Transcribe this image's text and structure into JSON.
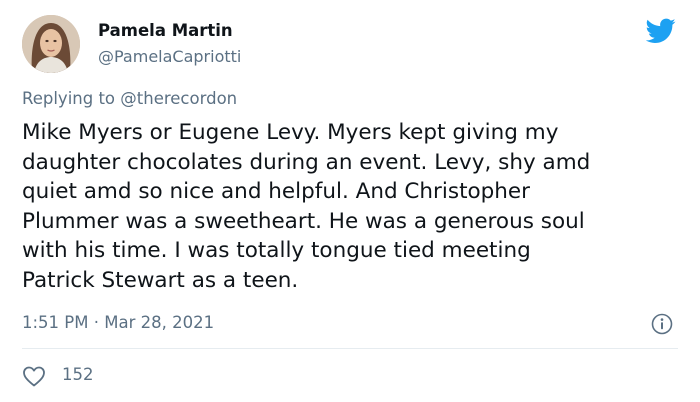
{
  "author": {
    "name": "Pamela Martin",
    "handle": "@PamelaCapriotti"
  },
  "reply": {
    "prefix": "Replying to ",
    "mention": "@therecordon"
  },
  "tweet": {
    "text": "Mike Myers or Eugene Levy. Myers kept giving my\ndaughter chocolates during an event. Levy, shy amd\nquiet amd so nice and helpful. And Christopher\nPlummer was a sweetheart. He was a generous soul\nwith his time. I was totally tongue tied meeting\nPatrick Stewart as a teen.",
    "time": "1:51 PM",
    "separator": " · ",
    "date": "Mar 28, 2021"
  },
  "engagement": {
    "likes": "152"
  },
  "icons": {
    "brand": "twitter-bird-icon",
    "info": "info-icon",
    "like": "heart-icon"
  },
  "colors": {
    "brand_blue": "#1da1f2",
    "secondary_text": "#5b7083",
    "primary_text": "#0f1419"
  }
}
